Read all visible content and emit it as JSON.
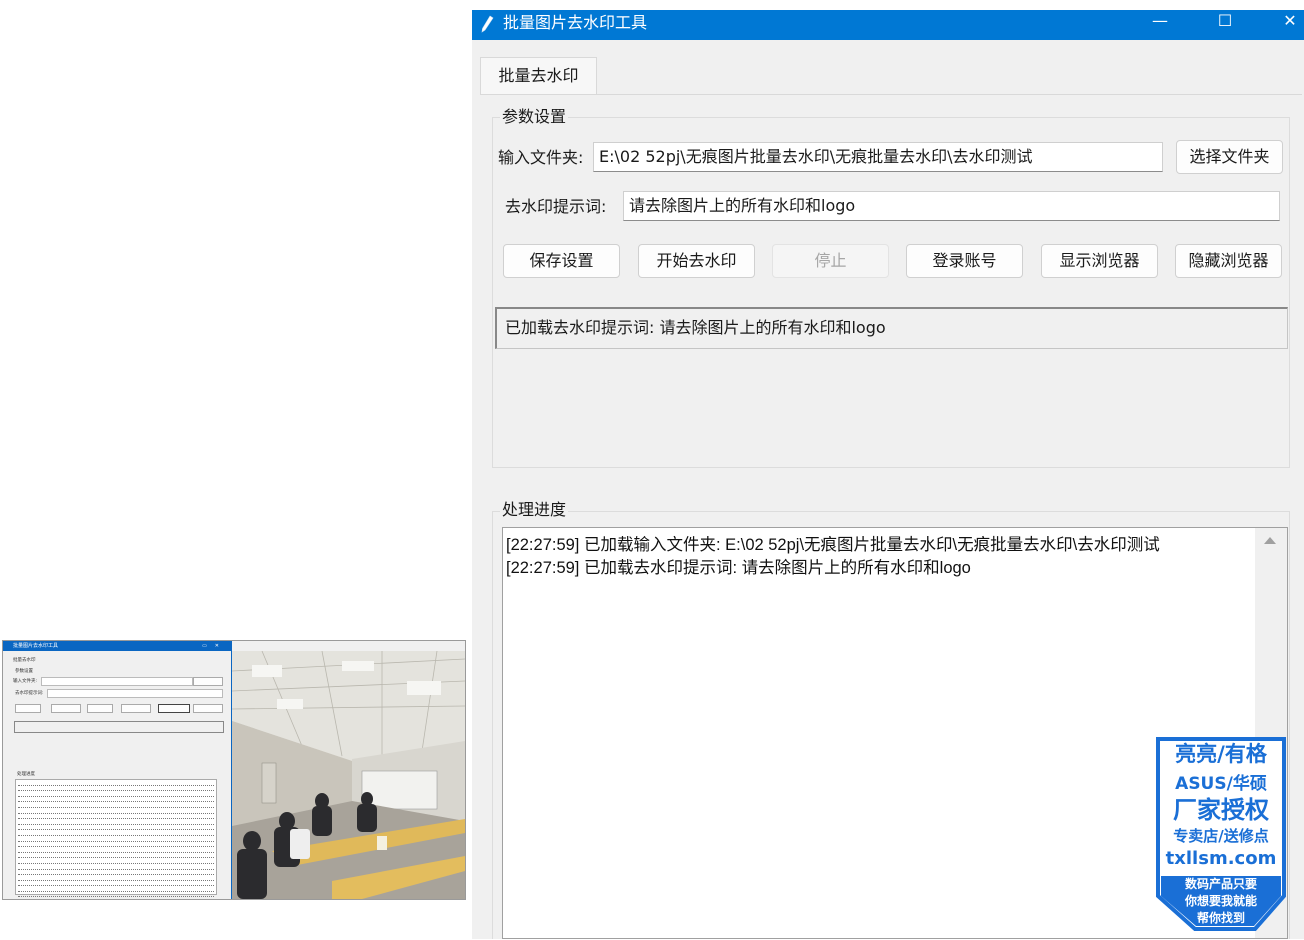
{
  "window": {
    "title": "批量图片去水印工具",
    "controls": {
      "minimize": "—",
      "maximize": "☐",
      "close": "✕"
    }
  },
  "tabs": [
    {
      "label": "批量去水印",
      "active": true
    }
  ],
  "settings": {
    "group_label": "参数设置",
    "input_folder_label": "输入文件夹:",
    "input_folder_value": "E:\\02 52pj\\无痕图片批量去水印\\无痕批量去水印\\去水印测试",
    "select_folder_button": "选择文件夹",
    "prompt_label": "去水印提示词:",
    "prompt_value": "请去除图片上的所有水印和logo",
    "buttons": {
      "save": "保存设置",
      "start": "开始去水印",
      "stop": "停止",
      "login": "登录账号",
      "show_browser": "显示浏览器",
      "hide_browser": "隐藏浏览器"
    },
    "status_text": "已加载去水印提示词: 请去除图片上的所有水印和logo"
  },
  "progress": {
    "group_label": "处理进度",
    "log_lines": [
      "[22:27:59] 已加载输入文件夹: E:\\02 52pj\\无痕图片批量去水印\\无痕批量去水印\\去水印测试",
      "[22:27:59] 已加载去水印提示词: 请去除图片上的所有水印和logo"
    ]
  },
  "badge": {
    "lines": [
      "亮亮/有格",
      "ASUS/华硕",
      "厂家授权",
      "专卖店/送修点",
      "txllsm.com",
      "数码产品只要",
      "你想要我就能",
      "帮你找到"
    ]
  },
  "colors": {
    "titlebar": "#0078d4",
    "badge_blue": "#1a6fd6",
    "window_bg": "#f0f0f0"
  },
  "icons": [
    "pen-icon",
    "scroll-up-arrow-icon"
  ]
}
